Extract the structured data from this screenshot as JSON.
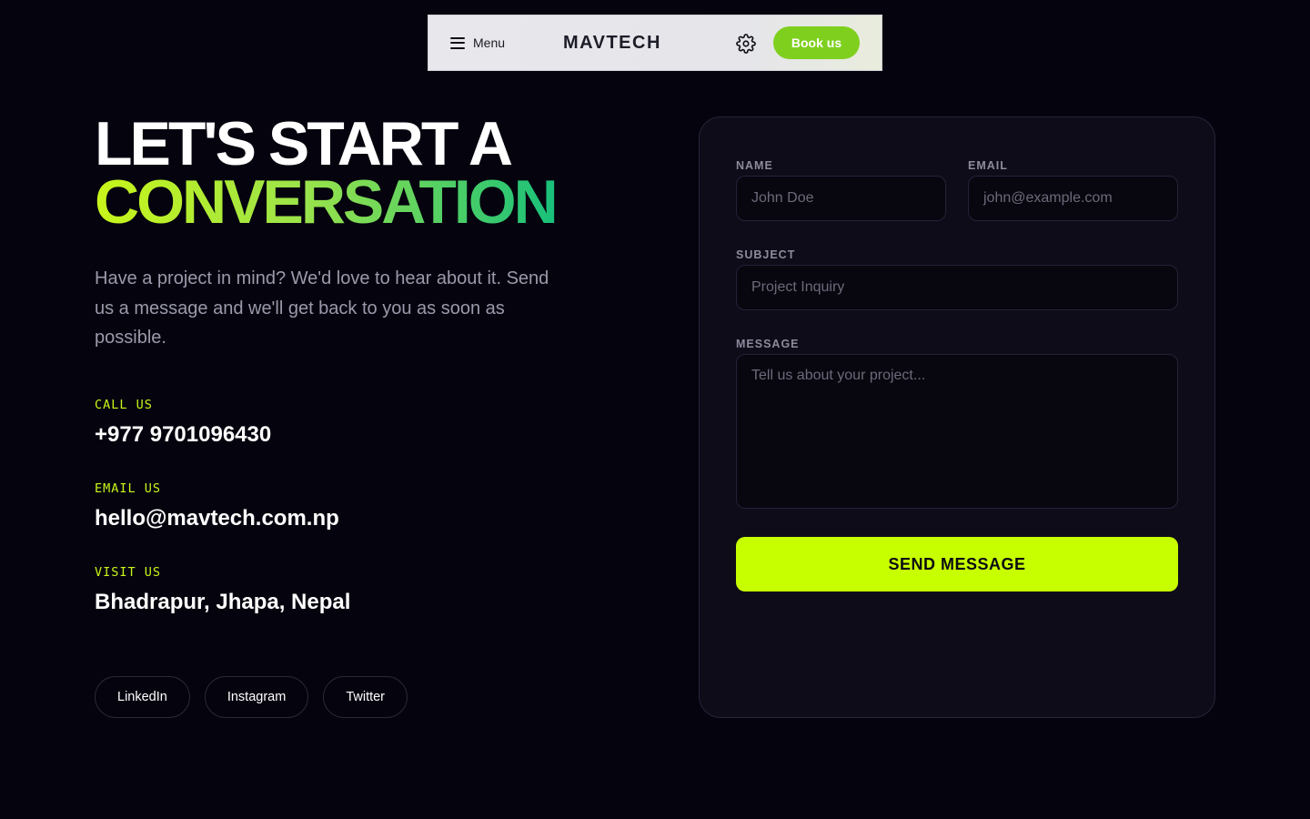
{
  "nav": {
    "menu_label": "Menu",
    "brand": "MAVTECH",
    "settings_icon": "gear-icon",
    "cta_label": "Book us"
  },
  "hero": {
    "line1": "LET'S START A",
    "line2": "CONVERSATION",
    "intro": "Have a project in mind? We'd love to hear about it. Send us a message and we'll get back to you as soon as possible."
  },
  "contacts": [
    {
      "label": "CALL US",
      "value": "+977 9701096430"
    },
    {
      "label": "EMAIL US",
      "value": "hello@mavtech.com.np"
    },
    {
      "label": "VISIT US",
      "value": "Bhadrapur, Jhapa, Nepal"
    }
  ],
  "socials": [
    "LinkedIn",
    "Instagram",
    "Twitter"
  ],
  "form": {
    "name": {
      "label": "NAME",
      "placeholder": "John Doe"
    },
    "email": {
      "label": "EMAIL",
      "placeholder": "john@example.com"
    },
    "subject": {
      "label": "SUBJECT",
      "placeholder": "Project Inquiry"
    },
    "message": {
      "label": "MESSAGE",
      "placeholder": "Tell us about your project..."
    },
    "submit_label": "SEND MESSAGE"
  },
  "colors": {
    "background": "#05030e",
    "accent": "#c8ff00",
    "cta_green": "#7fd01e",
    "gradient_end": "#18c07a"
  }
}
